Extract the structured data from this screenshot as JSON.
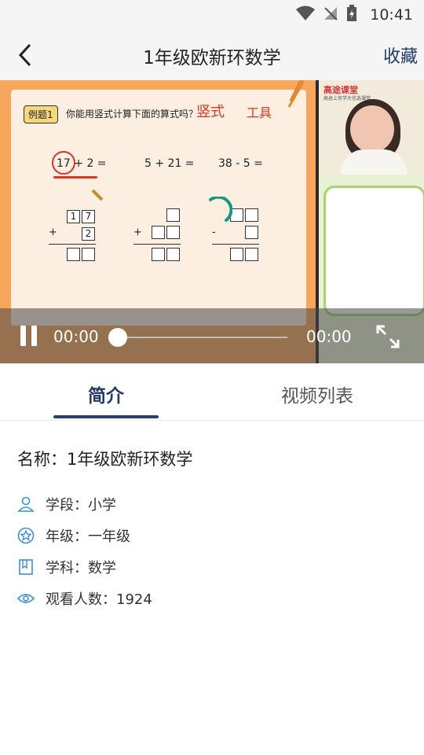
{
  "status_bar": {
    "time": "10:41"
  },
  "header": {
    "title": "1年级欧新环数学",
    "favorite_label": "收藏"
  },
  "video": {
    "board": {
      "example_tag": "例题1",
      "question": "你能用竖式计算下面的算式吗？",
      "handwritten_note_1": "竖式",
      "handwritten_note_2": "工具",
      "expressions": [
        "17 + 2 =",
        "5 + 21 =",
        "38 - 5 ="
      ],
      "calc1": {
        "top": [
          "1",
          "7"
        ],
        "op": "+",
        "bottom": "2"
      },
      "calc2_op": "+",
      "calc3_op": "-"
    },
    "teacher_panel": {
      "brand": "高途课堂",
      "brand_sub": "高途上有学大优选课堂"
    },
    "controls": {
      "current_time": "00:00",
      "total_time": "00:00",
      "progress": 0.0
    }
  },
  "tabs": [
    {
      "label": "简介",
      "active": true
    },
    {
      "label": "视频列表",
      "active": false
    }
  ],
  "info": {
    "name": "名称：1年级欧新环数学",
    "rows": [
      {
        "icon": "user-icon",
        "text": "学段：小学"
      },
      {
        "icon": "star-badge-icon",
        "text": "年级：一年级"
      },
      {
        "icon": "book-icon",
        "text": "学科：数学"
      },
      {
        "icon": "eye-icon",
        "text": "观看人数：1924"
      }
    ]
  },
  "colors": {
    "accent": "#1f3a6a",
    "tab_underline": "#2b3f66",
    "icon_blue": "#3a8fd6",
    "spinner": "#139a85"
  }
}
